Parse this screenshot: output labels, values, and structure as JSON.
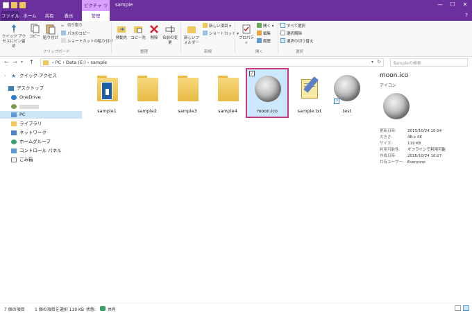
{
  "window": {
    "context_tab": "ピクチャ ツール",
    "title": "sample",
    "controls": {
      "minimize": "—",
      "maximize": "☐",
      "close": "✕"
    }
  },
  "tabs": [
    "ファイル",
    "ホーム",
    "共有",
    "表示",
    "管理"
  ],
  "help": "?",
  "ribbon": {
    "clipboard": {
      "pin": "クイック アクセスにピン留め",
      "copy": "コピー",
      "paste": "貼り付け",
      "cut": "切り取り",
      "copy_path": "パスのコピー",
      "paste_shortcut": "ショートカットの貼り付け",
      "label": "クリップボード"
    },
    "organize": {
      "move_to": "移動先",
      "copy_to": "コピー先",
      "delete": "削除",
      "rename": "名前の変更",
      "label": "整理"
    },
    "new": {
      "new_folder": "新しいフォルダー",
      "new_item": "新しい項目 ▾",
      "shortcut": "ショートカット ▾",
      "label": "新規"
    },
    "open": {
      "properties": "プロパティ",
      "open": "開く ▾",
      "edit": "編集",
      "history": "履歴",
      "label": "開く"
    },
    "select": {
      "select_all": "すべて選択",
      "select_none": "選択解除",
      "invert": "選択の切り替え",
      "label": "選択"
    }
  },
  "address": {
    "crumbs": "›  PC  ›  Data (E:)  ›  sample",
    "search_placeholder": "sampleの検索"
  },
  "nav": [
    {
      "label": "クイック アクセス",
      "icon": "star-icon"
    },
    {
      "label": "デスクトップ",
      "icon": "desktop-icon"
    },
    {
      "label": "OneDrive",
      "icon": "cloud-icon"
    },
    {
      "label": "",
      "icon": "user-icon"
    },
    {
      "label": "PC",
      "icon": "pc-icon"
    },
    {
      "label": "ライブラリ",
      "icon": "library-icon"
    },
    {
      "label": "ネットワーク",
      "icon": "network-icon"
    },
    {
      "label": "ホームグループ",
      "icon": "homegroup-icon"
    },
    {
      "label": "コントロール パネル",
      "icon": "control-panel-icon"
    },
    {
      "label": "ごみ箱",
      "icon": "recycle-bin-icon"
    }
  ],
  "files": [
    {
      "name": "sample1",
      "kind": "folder-with-doc"
    },
    {
      "name": "sample2",
      "kind": "folder"
    },
    {
      "name": "sample3",
      "kind": "folder"
    },
    {
      "name": "sample4",
      "kind": "folder"
    },
    {
      "name": "moon.ico",
      "kind": "moon"
    },
    {
      "name": "sample.txt",
      "kind": "notepad"
    },
    {
      "name": "test",
      "kind": "moon-shortcut"
    }
  ],
  "details": {
    "file_name": "moon.ico",
    "file_type": "アイコン",
    "props": [
      {
        "k": "更新日時:",
        "v": "2015/10/24 10:14"
      },
      {
        "k": "大きさ:",
        "v": "48 x 48"
      },
      {
        "k": "サイズ:",
        "v": "119 KB"
      },
      {
        "k": "利用可能性:",
        "v": "オフラインで利用可能"
      },
      {
        "k": "作成日時:",
        "v": "2015/10/24 10:17"
      },
      {
        "k": "共有ユーザー:",
        "v": "Everyone"
      }
    ]
  },
  "status": {
    "count": "7 個の項目",
    "selected": "1 個の項目を選択  119 KB",
    "state": "状態: ",
    "shared": "共有"
  },
  "colors": {
    "accent": "#6b2f9e",
    "selection_border": "#d0347a",
    "selection_fill": "#cce8ff"
  }
}
